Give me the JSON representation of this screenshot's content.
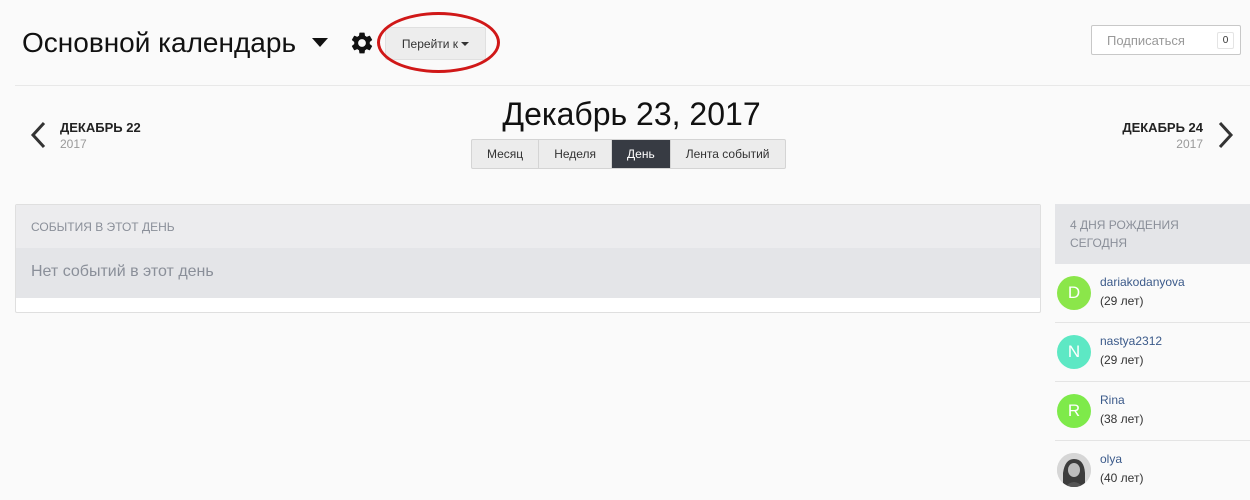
{
  "header": {
    "title": "Основной календарь",
    "jump_label": "Перейти к",
    "subscribe_label": "Подписаться",
    "subscribe_count": "0",
    "highlight_color": "#d01818"
  },
  "date_nav": {
    "prev_title": "ДЕКАБРЬ 22",
    "prev_year": "2017",
    "next_title": "ДЕКАБРЬ 24",
    "next_year": "2017",
    "current_date": "Декабрь 23, 2017"
  },
  "view_tabs": [
    {
      "label": "Месяц",
      "active": false
    },
    {
      "label": "Неделя",
      "active": false
    },
    {
      "label": "День",
      "active": true
    },
    {
      "label": "Лента событий",
      "active": false
    }
  ],
  "events": {
    "header": "События в этот день",
    "empty_text": "Нет событий в этот день"
  },
  "birthdays": {
    "header": "4 дня рождения сегодня",
    "items": [
      {
        "initial": "D",
        "name": "dariakodanyova",
        "age": "(29 лет)",
        "avatar_color": "#8be64a",
        "avatar_type": "letter"
      },
      {
        "initial": "N",
        "name": "nastya2312",
        "age": "(29 лет)",
        "avatar_color": "#5de8c4",
        "avatar_type": "letter"
      },
      {
        "initial": "R",
        "name": "Rina",
        "age": "(38 лет)",
        "avatar_color": "#7eea4a",
        "avatar_type": "letter"
      },
      {
        "initial": "",
        "name": "olya",
        "age": "(40 лет)",
        "avatar_color": "#5a5a5a",
        "avatar_type": "photo"
      }
    ]
  }
}
